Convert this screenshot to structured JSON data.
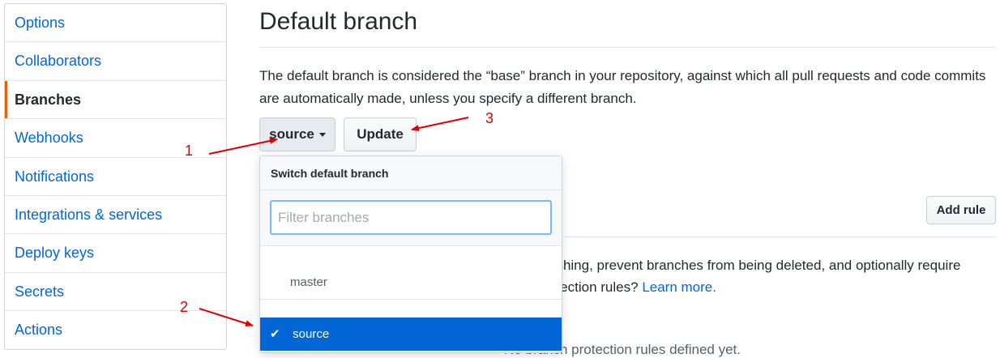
{
  "sidebar": {
    "items": [
      {
        "label": "Options"
      },
      {
        "label": "Collaborators"
      },
      {
        "label": "Branches"
      },
      {
        "label": "Webhooks"
      },
      {
        "label": "Notifications"
      },
      {
        "label": "Integrations & services"
      },
      {
        "label": "Deploy keys"
      },
      {
        "label": "Secrets"
      },
      {
        "label": "Actions"
      }
    ],
    "selected": "Branches"
  },
  "main": {
    "title": "Default branch",
    "description": "The default branch is considered the “base” branch in your repository, against which all pull requests and code commits are automatically made, unless you specify a different branch.",
    "branch_button_label": "source",
    "update_button_label": "Update",
    "add_rule_label": "Add rule",
    "protection_text_line1": "ushing, prevent branches from being deleted, and optionally require",
    "protection_text_line2": "otection rules?",
    "learn_more_label": "Learn more.",
    "empty_text": "No branch protection rules defined yet."
  },
  "dropdown": {
    "header": "Switch default branch",
    "filter_placeholder": "Filter branches",
    "filter_value": "",
    "branches": [
      {
        "name": "master",
        "selected": false
      },
      {
        "name": "source",
        "selected": true
      }
    ],
    "check_glyph": "✔"
  },
  "annotations": {
    "labels": [
      "1",
      "2",
      "3"
    ],
    "color": "#e00000"
  },
  "colors": {
    "link": "#0366d6",
    "selected_accent": "#e36209",
    "selected_item_bg": "#0366d6",
    "filter_focus": "#79b8ff"
  }
}
